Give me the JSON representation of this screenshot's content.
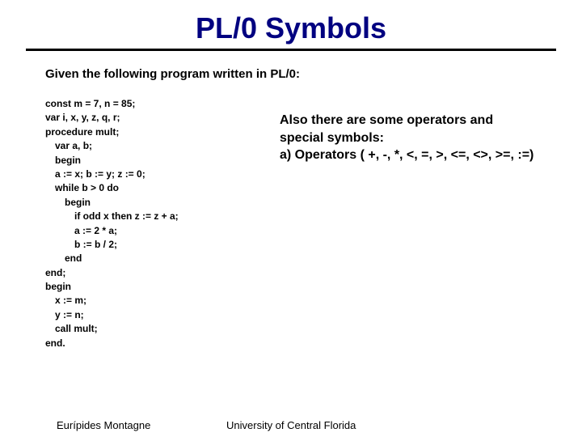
{
  "title": "PL/0 Symbols",
  "intro": "Given the following program written in PL/0:",
  "code": {
    "l1": "const m = 7, n = 85;",
    "l2": "var  i, x, y, z, q, r;",
    "l3": "procedure mult;",
    "l4": "var a, b;",
    "l5": "begin",
    "l6": "a := x;   b := y;  z := 0;",
    "l7": "while b > 0 do",
    "l8": "begin",
    "l9": "if odd x then z := z + a;",
    "l10": "a := 2 *  a;",
    "l11": "b := b / 2;",
    "l12": "end",
    "l13": "end;",
    "l14": "begin",
    "l15": "x := m;",
    "l16": "y := n;",
    "l17": "call mult;",
    "l18": "end."
  },
  "right": {
    "line1": "Also there are some operators and",
    "line2": "special symbols:",
    "line3": "a)    Operators ( +, -, *, <, =, >, <=, <>, >=, :=)"
  },
  "footer": {
    "author": "Eurípides Montagne",
    "org": "University of Central Florida"
  }
}
